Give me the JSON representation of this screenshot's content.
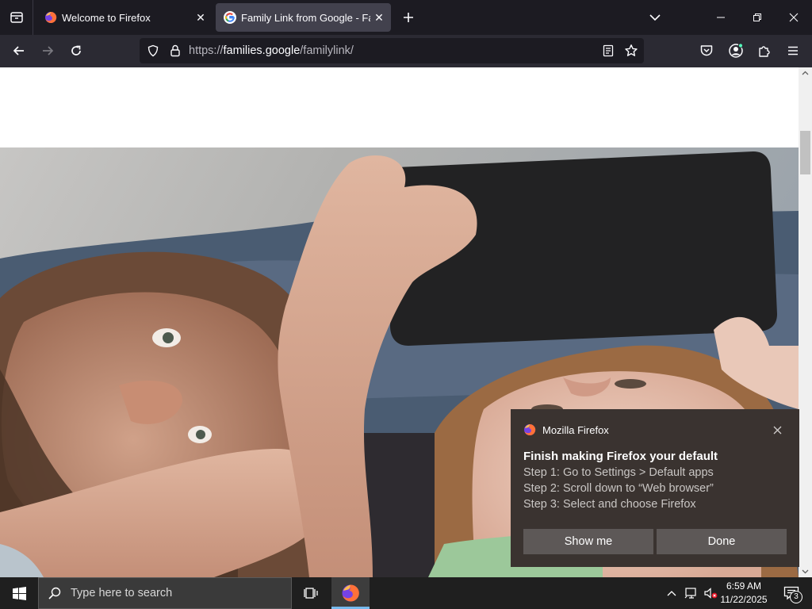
{
  "browser": {
    "tabs": [
      {
        "title": "Welcome to Firefox",
        "favicon": "firefox-icon",
        "active": false
      },
      {
        "title": "Family Link from Google - Famil",
        "favicon": "google-g-icon",
        "active": true
      }
    ],
    "url": {
      "prefix": "https://",
      "host": "families.google",
      "path": "/familylink/"
    }
  },
  "toast": {
    "app_name": "Mozilla Firefox",
    "title": "Finish making Firefox your default",
    "steps": [
      "Step 1: Go to Settings > Default apps",
      "Step 2: Scroll down to “Web browser”",
      "Step 3: Select and choose Firefox"
    ],
    "primary_button": "Show me",
    "secondary_button": "Done"
  },
  "taskbar": {
    "search_placeholder": "Type here to search",
    "time": "6:59 AM",
    "date": "11/22/2025",
    "notification_count": "3"
  },
  "colors": {
    "chrome_dark": "#1c1b22",
    "toolbar": "#2b2a33",
    "active_tab": "#42414d",
    "toast_bg": "#3a3330",
    "toast_button": "#5d5857",
    "taskbar": "#1f1f1f",
    "taskbar_accent": "#76b9ed"
  }
}
